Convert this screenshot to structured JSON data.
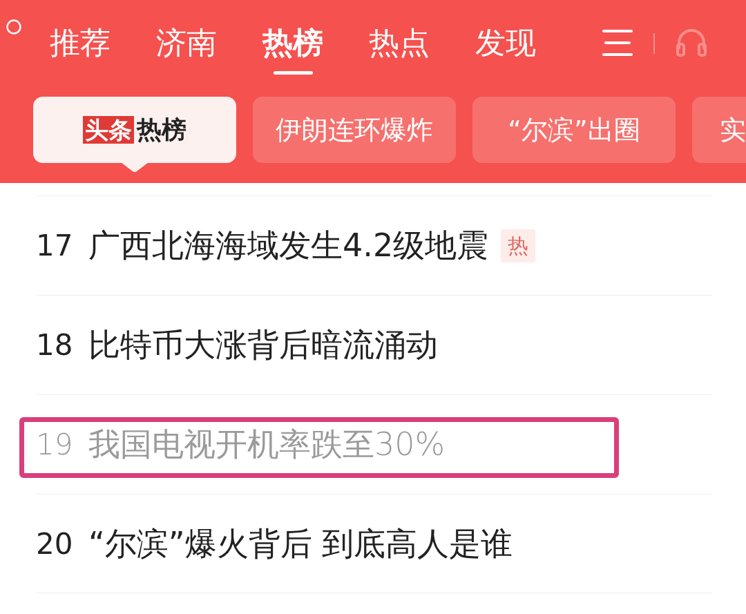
{
  "top_tabs": [
    {
      "label": "推荐",
      "selected": false
    },
    {
      "label": "济南",
      "selected": false
    },
    {
      "label": "热榜",
      "selected": true
    },
    {
      "label": "热点",
      "selected": false
    },
    {
      "label": "发现",
      "selected": false
    }
  ],
  "topic_chips": [
    {
      "logo": "头条",
      "label": "热榜",
      "selected": true
    },
    {
      "label": "伊朗连环爆炸",
      "selected": false
    },
    {
      "label": "“尔滨”出圈",
      "selected": false
    },
    {
      "label": "实",
      "selected": false
    }
  ],
  "hot_list": [
    {
      "rank": "17",
      "title": "广西北海海域发生4.2级地震",
      "badge": "热",
      "read": false,
      "highlighted": false
    },
    {
      "rank": "18",
      "title": "比特币大涨背后暗流涌动",
      "read": false,
      "highlighted": false
    },
    {
      "rank": "19",
      "title": "我国电视开机率跌至30%",
      "read": true,
      "highlighted": true
    },
    {
      "rank": "20",
      "title": "“尔滨”爆火背后 到底高人是谁",
      "read": false,
      "highlighted": false
    }
  ]
}
